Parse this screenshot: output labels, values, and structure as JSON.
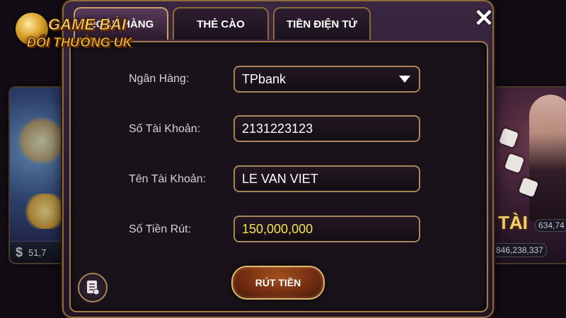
{
  "logo": {
    "line1": "GAME BÀI",
    "line2": "ĐỔI THƯỞNG UK"
  },
  "tabs": [
    {
      "label": "NGÂN HÀNG",
      "active": true
    },
    {
      "label": "THẺ CÀO",
      "active": false
    },
    {
      "label": "TIỀN ĐIỆN TỬ",
      "active": false
    }
  ],
  "close_icon": "close-icon",
  "form": {
    "bank_label": "Ngân Hàng:",
    "bank_value": "TPbank",
    "account_number_label": "Số Tài Khoản:",
    "account_number_value": "2131223123",
    "account_name_label": "Tên Tài Khoản:",
    "account_name_value": "LE VAN VIET",
    "amount_label": "Số Tiền Rút:",
    "amount_value": "150,000,000",
    "submit_label": "RÚT TIỀN"
  },
  "background": {
    "left_tile_amount": "51,7",
    "right_tile_label": "TÀI",
    "right_tile_value1": "634,74",
    "right_tile_value2": "846,238,337"
  },
  "colors": {
    "accent_gold": "#a9865a",
    "amount_yellow": "#f7e34a",
    "panel_bg": "#19121a"
  }
}
